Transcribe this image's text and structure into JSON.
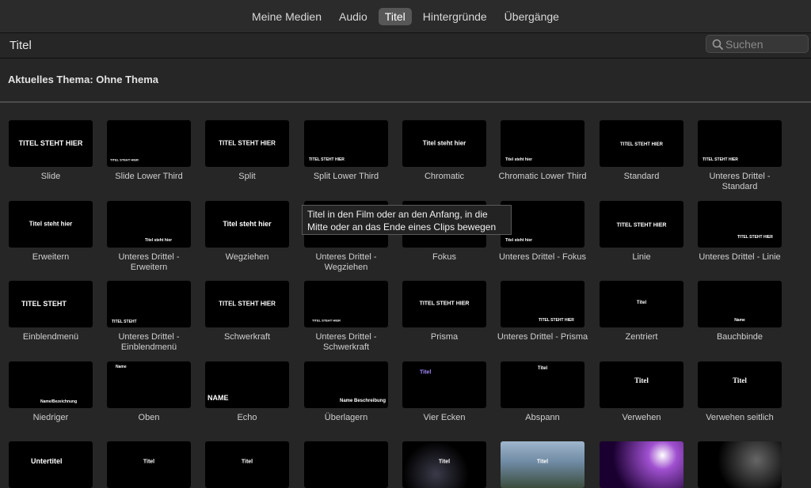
{
  "tabs": [
    {
      "label": "Meine Medien",
      "active": false
    },
    {
      "label": "Audio",
      "active": false
    },
    {
      "label": "Titel",
      "active": true
    },
    {
      "label": "Hintergründe",
      "active": false
    },
    {
      "label": "Übergänge",
      "active": false
    }
  ],
  "subbar": {
    "title": "Titel"
  },
  "search": {
    "placeholder": "Suchen",
    "value": ""
  },
  "theme": {
    "title": "Aktuelles Thema: Ohne Thema"
  },
  "tooltip": {
    "text": "Titel in den Film oder an den Anfang, in die Mitte oder an das Ende eines Clips bewegen"
  },
  "tiles": [
    {
      "label": "Slide",
      "thumb_text": "TITEL STEHT HIER"
    },
    {
      "label": "Slide Lower Third",
      "thumb_text": "TITEL STEHT HIER"
    },
    {
      "label": "Split",
      "thumb_text": "TITEL STEHT HIER"
    },
    {
      "label": "Split Lower Third",
      "thumb_text": "TITEL STEHT HIER"
    },
    {
      "label": "Chromatic",
      "thumb_text": "Titel steht hier"
    },
    {
      "label": "Chromatic Lower Third",
      "thumb_text": "Titel steht hier"
    },
    {
      "label": "Standard",
      "thumb_text": "TITEL STEHT HIER"
    },
    {
      "label": "Unteres Drittel - Standard",
      "thumb_text": "TITEL STEHT HIER"
    },
    {
      "label": "Erweitern",
      "thumb_text": "Titel steht hier"
    },
    {
      "label": "Unteres Drittel - Erweitern",
      "thumb_text": "Titel steht hier"
    },
    {
      "label": "Wegziehen",
      "thumb_text": "Titel steht hier"
    },
    {
      "label": "Unteres Drittel - Wegziehen",
      "thumb_text": ""
    },
    {
      "label": "Fokus",
      "thumb_text": ""
    },
    {
      "label": "Unteres Drittel - Fokus",
      "thumb_text": "Titel steht hier"
    },
    {
      "label": "Linie",
      "thumb_text": "TITEL STEHT HIER"
    },
    {
      "label": "Unteres Drittel - Linie",
      "thumb_text": "TITEL STEHT HIER"
    },
    {
      "label": "Einblendmenü",
      "thumb_text": "TITEL STEHT"
    },
    {
      "label": "Unteres Drittel - Einblendmenü",
      "thumb_text": "TITEL STEHT"
    },
    {
      "label": "Schwerkraft",
      "thumb_text": "TITEL STEHT HIER"
    },
    {
      "label": "Unteres Drittel - Schwerkraft",
      "thumb_text": "TITEL STEHT HIER"
    },
    {
      "label": "Prisma",
      "thumb_text": "TITEL STEHT HIER"
    },
    {
      "label": "Unteres Drittel - Prisma",
      "thumb_text": "TITEL STEHT HIER"
    },
    {
      "label": "Zentriert",
      "thumb_text": "Titel"
    },
    {
      "label": "Bauchbinde",
      "thumb_text": "Name"
    },
    {
      "label": "Niedriger",
      "thumb_text": "Name/Bezeichnung"
    },
    {
      "label": "Oben",
      "thumb_text": "Name"
    },
    {
      "label": "Echo",
      "thumb_text": "NAME"
    },
    {
      "label": "Überlagern",
      "thumb_text": "Name Beschreibung"
    },
    {
      "label": "Vier Ecken",
      "thumb_text": "Titel"
    },
    {
      "label": "Abspann",
      "thumb_text": "Titel"
    },
    {
      "label": "Verwehen",
      "thumb_text": "Titel"
    },
    {
      "label": "Verwehen seitlich",
      "thumb_text": "Titel"
    },
    {
      "label": "",
      "thumb_text": "Untertitel"
    },
    {
      "label": "",
      "thumb_text": "Titel"
    },
    {
      "label": "",
      "thumb_text": "Titel"
    },
    {
      "label": "",
      "thumb_text": ""
    },
    {
      "label": "",
      "thumb_text": "Titel"
    },
    {
      "label": "",
      "thumb_text": "Titel"
    },
    {
      "label": "",
      "thumb_text": ""
    },
    {
      "label": "",
      "thumb_text": ""
    }
  ]
}
